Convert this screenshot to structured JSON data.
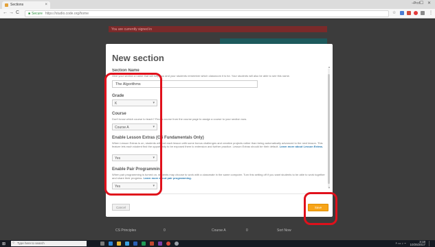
{
  "browser": {
    "tab_title": "Sections",
    "tab_close": "×",
    "user_chip": "Prof",
    "window_controls": "— ☐ ✕",
    "back": "←",
    "forward": "→",
    "reload": "C",
    "secure_label": "Secure",
    "url": "https://studio.code.org/home"
  },
  "page": {
    "banner_text": "You are currently signed in",
    "row_cells": [
      "CS Principles",
      "0",
      "Course A",
      "0",
      "Sort Now"
    ]
  },
  "modal": {
    "title": "New section",
    "section_name": {
      "label": "Section Name",
      "desc": "Give your section a name that will help you and your students remember which classroom it is for. Your students will also be able to see this name.",
      "value": "The Algorithms"
    },
    "grade": {
      "label": "Grade",
      "value": "K"
    },
    "course": {
      "label": "Course",
      "desc": "Don't know which course to teach? Find a course from the course page to assign a course to your section now.",
      "value": "Course A"
    },
    "lesson_extras": {
      "label": "Enable Lesson Extras (CS Fundamentals Only)",
      "desc": "When Lesson Extras is on, students will end each lesson with some bonus challenges and creative projects rather than being automatically advanced to the next lesson. This feature lets each student find the opportunity to be exposed them to extension and further practice. Lesson Extras should be their default.",
      "link": "Learn more about Lesson Extras.",
      "value": "Yes"
    },
    "pair_programming": {
      "label": "Enable Pair Programming",
      "desc": "When pair programming is turned on, students may choose to work with a classmate in the same computer. Turn this setting off if you want students to be able to work together and share their progress.",
      "link": "Learn more about pair programming.",
      "value": "Yes"
    },
    "cancel_label": "Cancel",
    "save_label": "Save"
  },
  "taskbar": {
    "search_placeholder": "Type here to search",
    "time": "3:18",
    "date": "10/25/2017"
  },
  "colors": {
    "accent": "#f7a418",
    "annotation": "#e0101b",
    "link": "#2a7ab0"
  }
}
